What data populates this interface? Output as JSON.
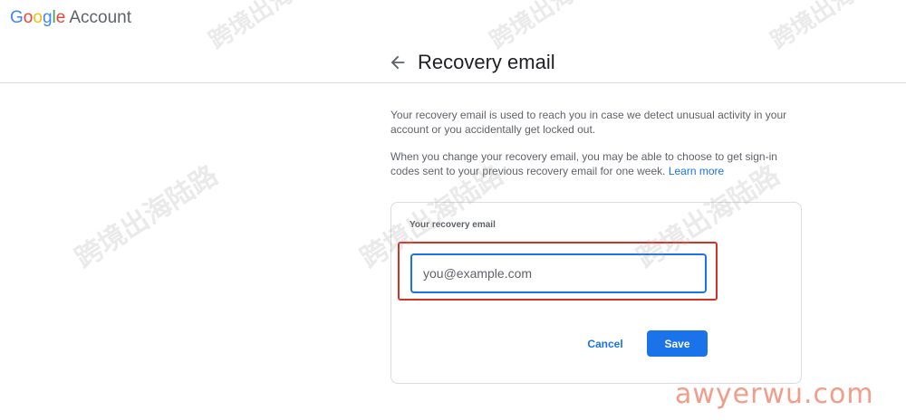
{
  "header": {
    "logo_google_letters": [
      "G",
      "o",
      "o",
      "g",
      "l",
      "e"
    ],
    "logo_product": "Account"
  },
  "page": {
    "title": "Recovery email",
    "description_1": "Your recovery email is used to reach you in case we detect unusual activity in your account or you accidentally get locked out.",
    "description_2": "When you change your recovery email, you may be able to choose to get sign-in codes sent to your previous recovery email for one week.",
    "learn_more": "Learn more"
  },
  "form": {
    "field_label": "Your recovery email",
    "email_placeholder": "you@example.com",
    "email_value": "",
    "cancel_label": "Cancel",
    "save_label": "Save"
  },
  "watermarks": {
    "overlay_text": "跨境出海陆路",
    "site_text": "awyerwu.com"
  },
  "colors": {
    "primary": "#1a73e8",
    "highlight": "#d93025",
    "logo_blue": "#4285F4",
    "logo_red": "#EA4335",
    "logo_yellow": "#FBBC05",
    "logo_green": "#34A853"
  },
  "icons": {
    "back": "arrow-left-icon"
  }
}
